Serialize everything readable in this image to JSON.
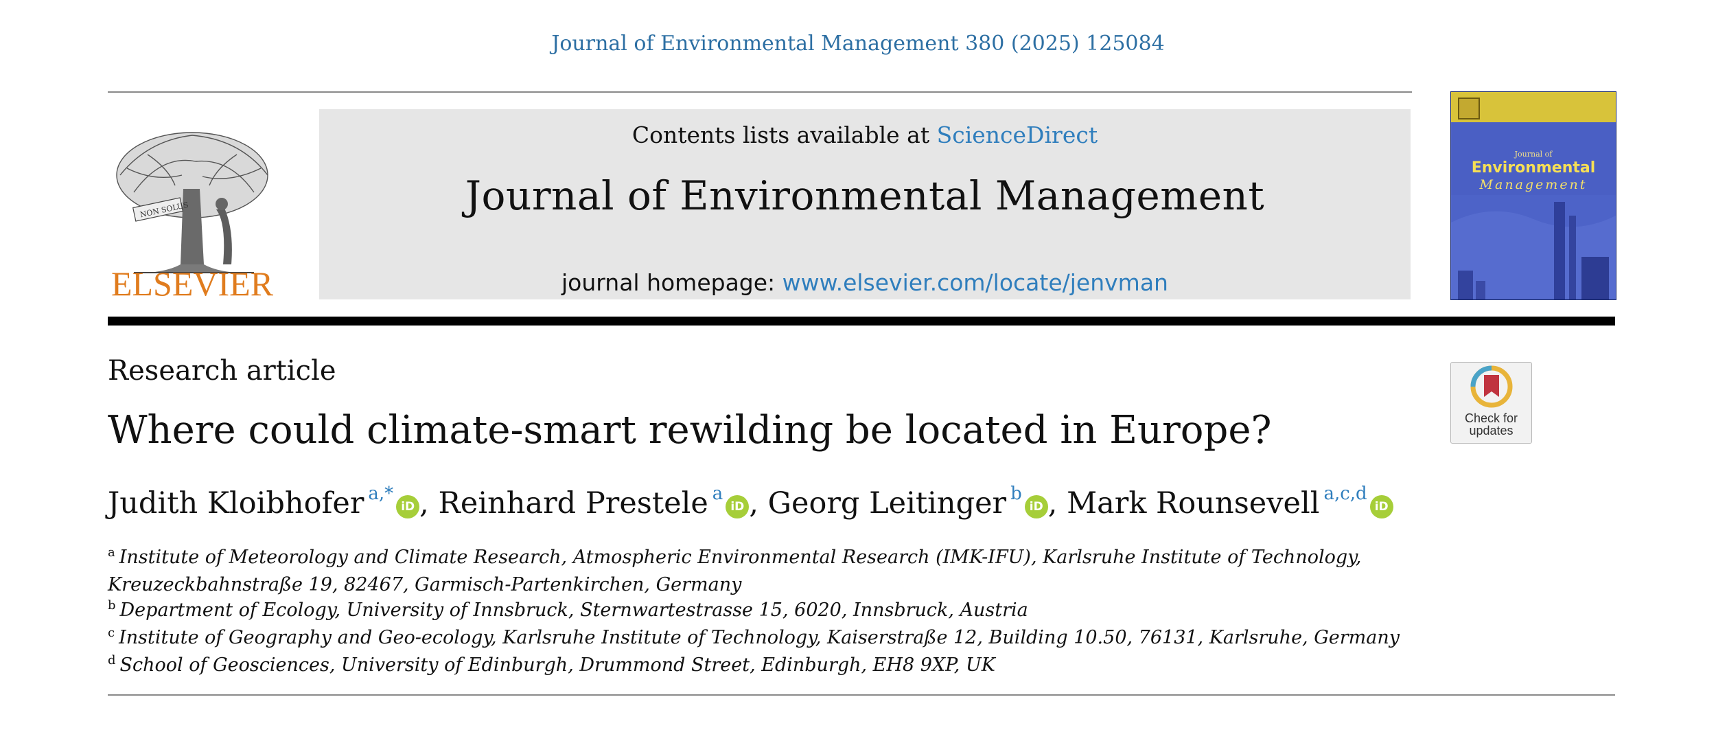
{
  "citation": "Journal of Environmental Management 380 (2025) 125084",
  "publisher": {
    "name": "ELSEVIER"
  },
  "masthead": {
    "contents_prefix": "Contents lists available at ",
    "contents_link": "ScienceDirect",
    "journal_title": "Journal of Environmental Management",
    "homepage_prefix": "journal homepage: ",
    "homepage_link": "www.elsevier.com/locate/jenvman"
  },
  "cover": {
    "line1": "Journal of",
    "line2": "Environmental",
    "line3": "Management"
  },
  "article": {
    "type": "Research article",
    "title": "Where could climate-smart rewilding be located in Europe?"
  },
  "check_updates": {
    "line1": "Check for",
    "line2": "updates"
  },
  "authors": [
    {
      "name": "Judith Kloibhofer",
      "affiliations": "a,*"
    },
    {
      "name": "Reinhard Prestele",
      "affiliations": "a"
    },
    {
      "name": "Georg Leitinger",
      "affiliations": "b"
    },
    {
      "name": "Mark Rounsevell",
      "affiliations": "a,c,d"
    }
  ],
  "author_separator": ", ",
  "orcid_label": "iD",
  "affiliations": [
    {
      "letter": "a",
      "text": "Institute of Meteorology and Climate Research, Atmospheric Environmental Research (IMK-IFU), Karlsruhe Institute of Technology, Kreuzeckbahnstraße 19, 82467, Garmisch-Partenkirchen, Germany"
    },
    {
      "letter": "b",
      "text": "Department of Ecology, University of Innsbruck, Sternwartestrasse 15, 6020, Innsbruck, Austria"
    },
    {
      "letter": "c",
      "text": "Institute of Geography and Geo-ecology, Karlsruhe Institute of Technology, Kaiserstraße 12, Building 10.50, 76131, Karlsruhe, Germany"
    },
    {
      "letter": "d",
      "text": "School of Geosciences, University of Edinburgh, Drummond Street, Edinburgh, EH8 9XP, UK"
    }
  ],
  "colors": {
    "link": "#2f7ebd",
    "elsevier_orange": "#e07c1e",
    "orcid_green": "#a6ce39",
    "cover_blue": "#4a5fc4",
    "cover_yellow": "#d8c33a"
  }
}
